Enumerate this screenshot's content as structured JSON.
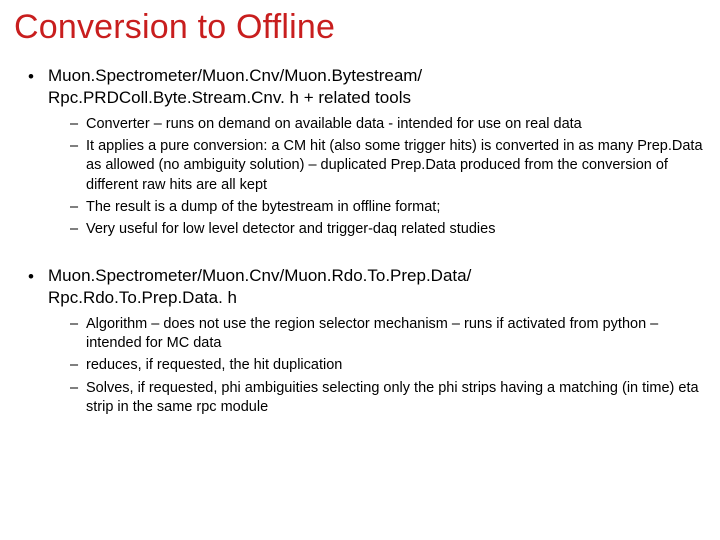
{
  "title": "Conversion to Offline",
  "sections": [
    {
      "heading_lines": [
        "Muon.Spectrometer/Muon.Cnv/Muon.Bytestream/",
        "Rpc.PRDColl.Byte.Stream.Cnv. h + related  tools"
      ],
      "items": [
        "Converter – runs on demand on available data - intended for use on real data",
        "It applies a pure conversion: a CM hit (also some trigger hits) is converted in as many Prep.Data as allowed (no ambiguity solution) – duplicated Prep.Data produced from the conversion of different raw hits are all kept",
        "The result is a dump of the bytestream in offline format;",
        "Very useful for low level detector and trigger-daq related studies"
      ]
    },
    {
      "heading_lines": [
        "Muon.Spectrometer/Muon.Cnv/Muon.Rdo.To.Prep.Data/",
        "Rpc.Rdo.To.Prep.Data. h"
      ],
      "items": [
        "Algorithm – does not use the region selector mechanism – runs if activated from python – intended for MC data",
        "reduces, if requested, the hit duplication",
        "Solves, if requested,  phi ambiguities selecting only the phi strips having a matching (in time) eta strip in the same rpc module"
      ]
    }
  ]
}
